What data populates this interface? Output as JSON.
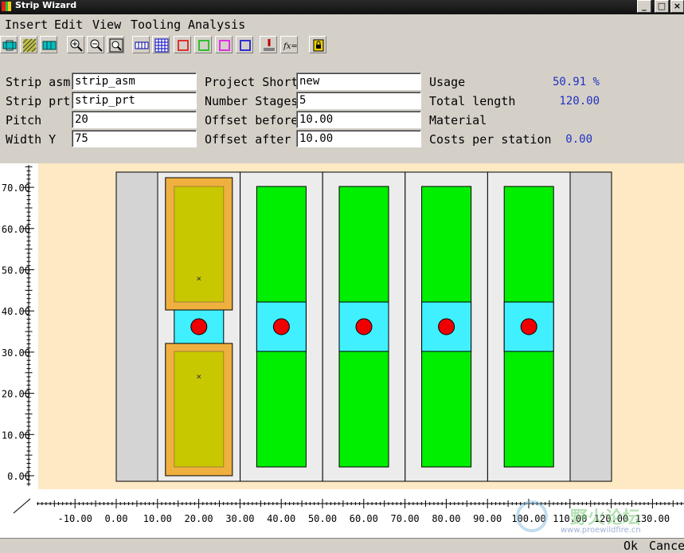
{
  "window": {
    "title": "Strip Wizard"
  },
  "menu": {
    "items": [
      "Insert",
      "Edit",
      "View",
      "Tooling",
      "Analysis"
    ]
  },
  "toolbar": {
    "icons": [
      "strip-layout-icon",
      "hatch-icon",
      "strip-grid-icon",
      "zoom-in-icon",
      "zoom-out-icon",
      "zoom-fit-icon",
      "strip-view-icon",
      "grid-icon",
      "red-square-icon",
      "green-square-icon",
      "magenta-square-icon",
      "blue-square-icon",
      "punch-icon",
      "function-icon",
      "lock-icon"
    ],
    "colors": {
      "red": "#e03030",
      "green": "#30c030",
      "magenta": "#e030e0",
      "blue": "#3030d0"
    }
  },
  "form": {
    "strip_asm_label": "Strip asm",
    "strip_asm_value": "strip_asm",
    "strip_prt_label": "Strip prt",
    "strip_prt_value": "strip_prt",
    "pitch_label": "Pitch",
    "pitch_value": "20",
    "width_label": "Width Y",
    "width_value": "75",
    "project_short_label": "Project Short",
    "project_short_value": "new",
    "stages_label": "Number Stages",
    "stages_value": "5",
    "offset_before_label": "Offset before",
    "offset_before_value": "10.00",
    "offset_after_label": "Offset after",
    "offset_after_value": "10.00",
    "usage_label": "Usage",
    "usage_value": "50.91 %",
    "total_length_label": "Total length",
    "total_length_value": "120.00",
    "material_label": "Material",
    "costs_label": "Costs per station",
    "costs_value": "0.00"
  },
  "ruler_y": {
    "ticks": [
      "70.00",
      "60.00",
      "50.00",
      "40.00",
      "30.00",
      "20.00",
      "10.00",
      "0.00"
    ]
  },
  "ruler_x": {
    "ticks": [
      "-10.00",
      "0.00",
      "10.00",
      "20.00",
      "30.00",
      "40.00",
      "50.00",
      "60.00",
      "70.00",
      "80.00",
      "90.00",
      "100.00",
      "110.00",
      "120.00",
      "130.00"
    ]
  },
  "strip": {
    "background": "#fde9c4",
    "stations": 5,
    "part_color": "#00ee00",
    "web_color": "#40f0ff",
    "pilot_color": "#ee0000",
    "first_part_color": "#c8c800",
    "first_part_border": "#f0b040",
    "marker": "×"
  },
  "buttons": {
    "ok": "Ok",
    "cancel": "Cancel"
  },
  "watermark": {
    "text": "野火论坛",
    "url": "www.proewildfire.cn"
  }
}
